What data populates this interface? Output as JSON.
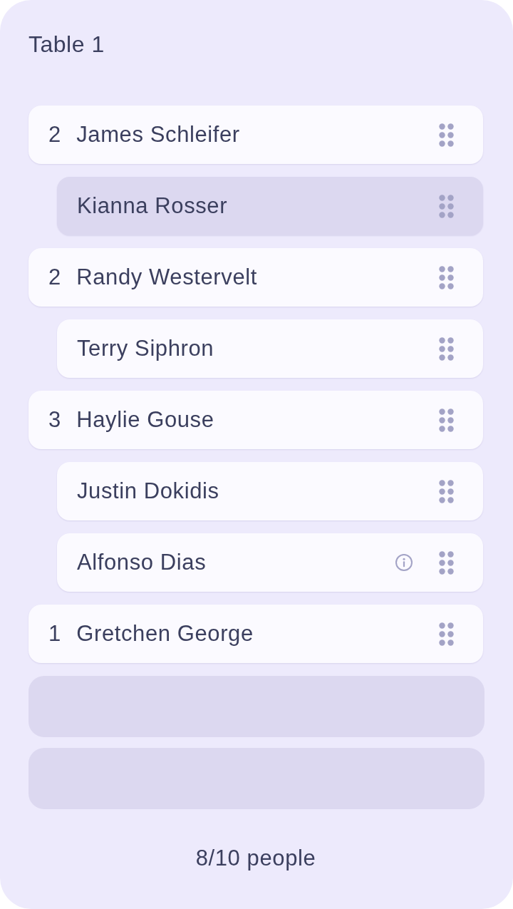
{
  "title": "Table 1",
  "rows": [
    {
      "kind": "party",
      "count": "2",
      "name": "James Schleifer",
      "selected": false,
      "info": false,
      "children": [
        {
          "name": "Kianna Rosser",
          "selected": true,
          "info": false
        }
      ]
    },
    {
      "kind": "party",
      "count": "2",
      "name": "Randy Westervelt",
      "selected": false,
      "info": false,
      "children": [
        {
          "name": "Terry Siphron",
          "selected": false,
          "info": false
        }
      ]
    },
    {
      "kind": "party",
      "count": "3",
      "name": "Haylie Gouse",
      "selected": false,
      "info": false,
      "children": [
        {
          "name": "Justin Dokidis",
          "selected": false,
          "info": false
        },
        {
          "name": "Alfonso Dias",
          "selected": false,
          "info": true
        }
      ]
    },
    {
      "kind": "party",
      "count": "1",
      "name": "Gretchen George",
      "selected": false,
      "info": false,
      "children": []
    },
    {
      "kind": "empty"
    },
    {
      "kind": "empty"
    }
  ],
  "footer": "8/10 people"
}
